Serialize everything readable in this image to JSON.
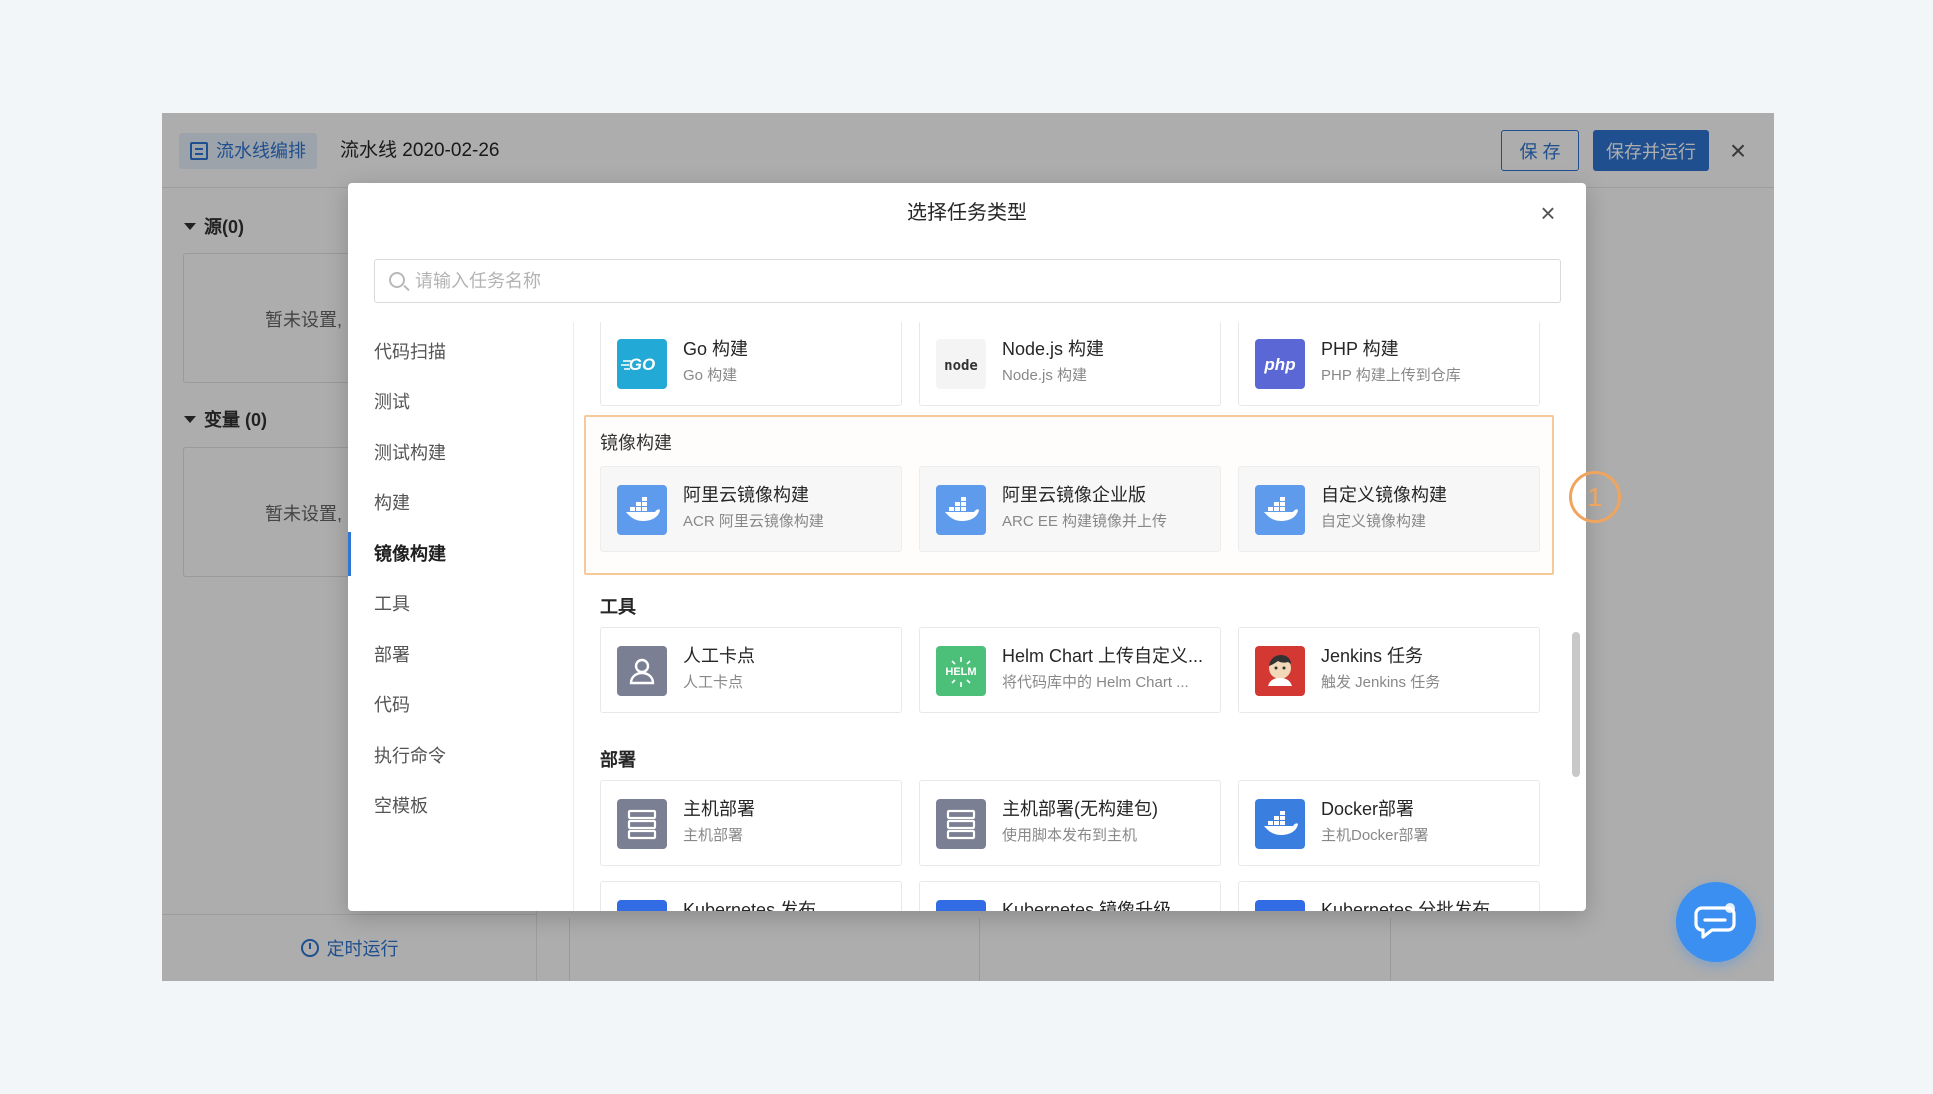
{
  "app": {
    "section_tag": "流水线编排",
    "pipeline_name": "流水线 2020-02-26",
    "save_label": "保 存",
    "save_run_label": "保存并运行",
    "left": {
      "source_title": "源(0)",
      "source_empty": "暂未设置,",
      "vars_title": "变量 (0)",
      "vars_empty": "暂未设置,",
      "schedule_label": "定时运行"
    }
  },
  "modal": {
    "title": "选择任务类型",
    "search_placeholder": "请输入任务名称",
    "categories": [
      "代码扫描",
      "测试",
      "测试构建",
      "构建",
      "镜像构建",
      "工具",
      "部署",
      "代码",
      "执行命令",
      "空模板"
    ],
    "active_category": "镜像构建",
    "groups": [
      {
        "title": "",
        "cards": [
          {
            "name": "Go 构建",
            "desc": "Go 构建",
            "icon": "go-icon",
            "color": "#22a9d6"
          },
          {
            "name": "Node.js 构建",
            "desc": "Node.js 构建",
            "icon": "nodejs-icon",
            "color": "#f4f4f4"
          },
          {
            "name": "PHP 构建",
            "desc": "PHP 构建上传到仓库",
            "icon": "php-icon",
            "color": "#5b67d4"
          }
        ]
      },
      {
        "title": "镜像构建",
        "cards": [
          {
            "name": "阿里云镜像构建",
            "desc": "ACR 阿里云镜像构建",
            "icon": "docker-icon",
            "color": "#5e9bec"
          },
          {
            "name": "阿里云镜像企业版",
            "desc": "ARC EE 构建镜像并上传",
            "icon": "docker-icon",
            "color": "#5e9bec"
          },
          {
            "name": "自定义镜像构建",
            "desc": "自定义镜像构建",
            "icon": "docker-icon",
            "color": "#5e9bec"
          }
        ]
      },
      {
        "title": "工具",
        "cards": [
          {
            "name": "人工卡点",
            "desc": "人工卡点",
            "icon": "person-icon",
            "color": "#7a7f93"
          },
          {
            "name": "Helm Chart 上传自定义...",
            "desc": "将代码库中的 Helm Chart ...",
            "icon": "helm-icon",
            "color": "#4cbf78"
          },
          {
            "name": "Jenkins 任务",
            "desc": "触发 Jenkins 任务",
            "icon": "jenkins-icon",
            "color": "#d33833"
          }
        ]
      },
      {
        "title": "部署",
        "cards": [
          {
            "name": "主机部署",
            "desc": "主机部署",
            "icon": "server-icon",
            "color": "#7a7f93"
          },
          {
            "name": "主机部署(无构建包)",
            "desc": "使用脚本发布到主机",
            "icon": "server-icon",
            "color": "#7a7f93"
          },
          {
            "name": "Docker部署",
            "desc": "主机Docker部署",
            "icon": "docker-icon",
            "color": "#3a7fe0"
          }
        ]
      },
      {
        "title": "",
        "cards": [
          {
            "name": "Kubernetes 发布",
            "desc": "",
            "icon": "kubernetes-icon",
            "color": "#326ce5"
          },
          {
            "name": "Kubernetes 镜像升级",
            "desc": "",
            "icon": "kubernetes-icon",
            "color": "#326ce5"
          },
          {
            "name": "Kubernetes 分批发布",
            "desc": "",
            "icon": "kubernetes-icon",
            "color": "#326ce5"
          }
        ]
      }
    ]
  },
  "step_badge": "1",
  "colors": {
    "primary": "#2f75d3",
    "highlight": "#f5c99a",
    "badge": "#f0a55e"
  }
}
